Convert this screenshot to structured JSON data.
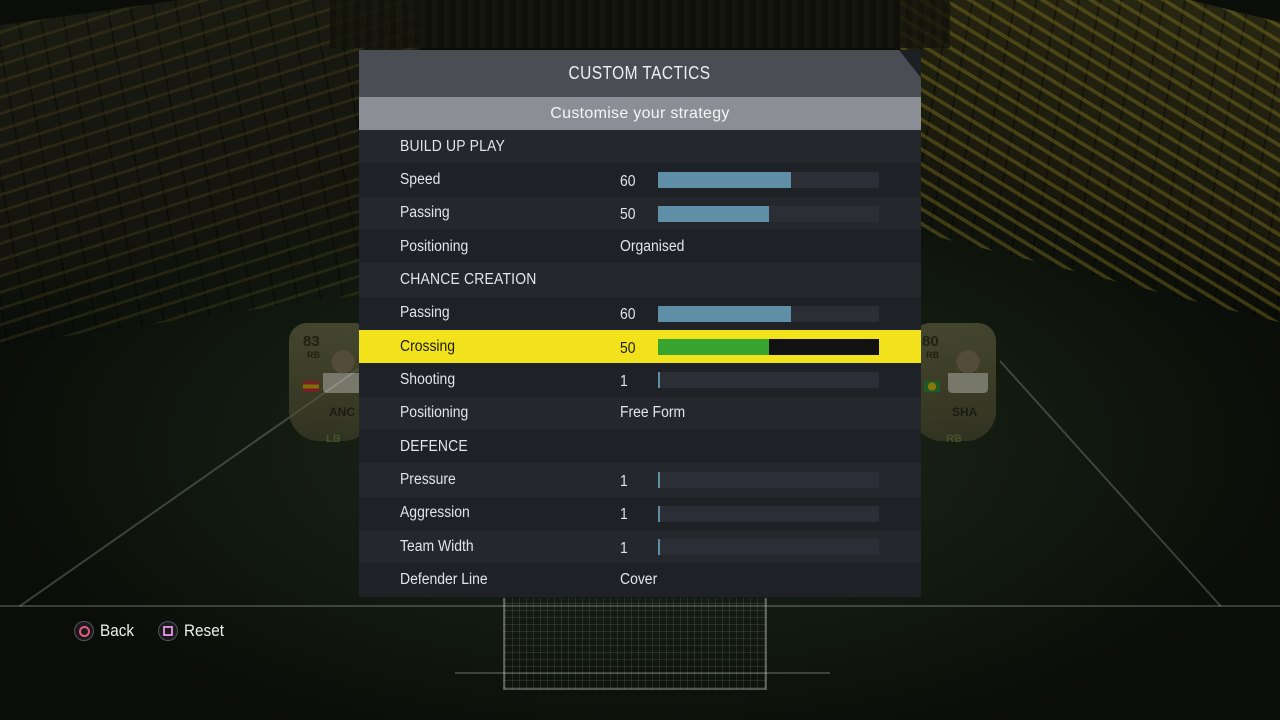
{
  "panel": {
    "title": "CUSTOM TACTICS",
    "subtitle": "Customise your strategy"
  },
  "rows": [
    {
      "type": "section",
      "label": "BUILD UP PLAY"
    },
    {
      "type": "slider",
      "label": "Speed",
      "value": "60",
      "level": 60
    },
    {
      "type": "slider",
      "label": "Passing",
      "value": "50",
      "level": 50
    },
    {
      "type": "option",
      "label": "Positioning",
      "value": "Organised"
    },
    {
      "type": "section",
      "label": "CHANCE CREATION"
    },
    {
      "type": "slider",
      "label": "Passing",
      "value": "60",
      "level": 60
    },
    {
      "type": "slider",
      "label": "Crossing",
      "value": "50",
      "level": 50,
      "selected": true
    },
    {
      "type": "slider",
      "label": "Shooting",
      "value": "1",
      "level": 1
    },
    {
      "type": "option",
      "label": "Positioning",
      "value": "Free Form"
    },
    {
      "type": "section",
      "label": "DEFENCE"
    },
    {
      "type": "slider",
      "label": "Pressure",
      "value": "1",
      "level": 1
    },
    {
      "type": "slider",
      "label": "Aggression",
      "value": "1",
      "level": 1
    },
    {
      "type": "slider",
      "label": "Team Width",
      "value": "1",
      "level": 1
    },
    {
      "type": "option",
      "label": "Defender Line",
      "value": "Cover"
    }
  ],
  "controls": {
    "back": {
      "label": "Back",
      "icon": "circle-button-icon"
    },
    "reset": {
      "label": "Reset",
      "icon": "square-button-icon"
    }
  },
  "cards": {
    "left": {
      "rating": "83",
      "position": "RB",
      "name": "ANC",
      "slot": "LB"
    },
    "right": {
      "rating": "80",
      "position": "RB",
      "name": "SHA",
      "slot": "RB"
    }
  },
  "colors": {
    "highlight": "#f2e21c",
    "bar_fill": "#5f8fa6",
    "bar_fill_selected": "#38a530",
    "header": "#4a4e54",
    "subheader": "#8b8f95"
  }
}
